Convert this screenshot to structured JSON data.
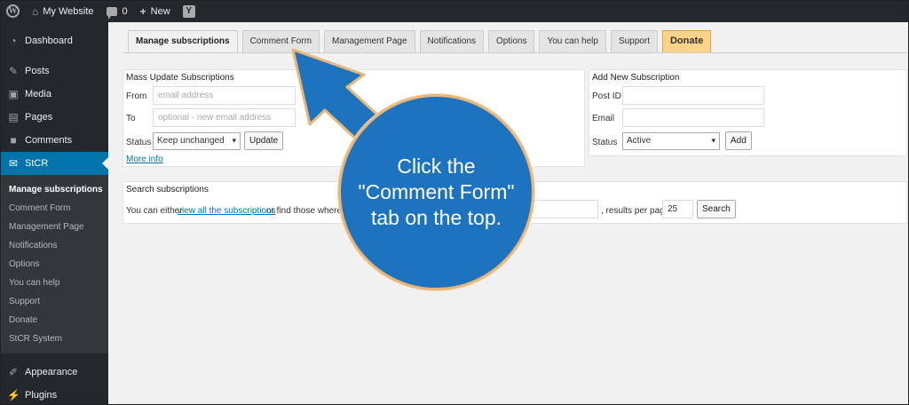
{
  "adminbar": {
    "site_name": "My Website",
    "comments_count": "0",
    "new_label": "New",
    "yoast_letter": "Y"
  },
  "sidebar": {
    "items_top": [
      {
        "label": "Dashboard",
        "icon": "dashboard-icon"
      },
      {
        "label": "Posts",
        "icon": "pin-icon"
      },
      {
        "label": "Media",
        "icon": "media-icon"
      },
      {
        "label": "Pages",
        "icon": "pages-icon"
      },
      {
        "label": "Comments",
        "icon": "comments-icon"
      },
      {
        "label": "StCR",
        "icon": "mail-icon"
      }
    ],
    "submenu": [
      "Manage subscriptions",
      "Comment Form",
      "Management Page",
      "Notifications",
      "Options",
      "You can help",
      "Support",
      "Donate",
      "StCR System"
    ],
    "items_bottom": [
      {
        "label": "Appearance",
        "icon": "brush-icon"
      },
      {
        "label": "Plugins",
        "icon": "plug-icon"
      }
    ]
  },
  "tabs": [
    "Manage subscriptions",
    "Comment Form",
    "Management Page",
    "Notifications",
    "Options",
    "You can help",
    "Support",
    "Donate"
  ],
  "mass_update": {
    "title": "Mass Update Subscriptions",
    "from_label": "From",
    "from_placeholder": "email address",
    "to_label": "To",
    "to_placeholder": "optional - new email address",
    "status_label": "Status",
    "status_value": "Keep unchanged",
    "update_button": "Update",
    "more_info": "More info"
  },
  "add_new": {
    "title": "Add New Subscription",
    "postid_label": "Post ID",
    "email_label": "Email",
    "status_label": "Status",
    "status_value": "Active",
    "add_button": "Add"
  },
  "search": {
    "title": "Search subscriptions",
    "text_before": "You can either",
    "view_all_link": "view all the subscriptions",
    "text_after": "or find those where th",
    "results_label": ", results per page:",
    "results_value": "25",
    "search_button": "Search"
  },
  "callout": {
    "text_line1": "Click the",
    "text_line2": "\"Comment Form\"",
    "text_line3": "tab on the top.",
    "circle_color": "#1e73be",
    "border_color": "#e8b57a"
  },
  "colors": {
    "adminbar": "#23282d",
    "accent": "#0073aa",
    "donate": "#fbd38b"
  }
}
